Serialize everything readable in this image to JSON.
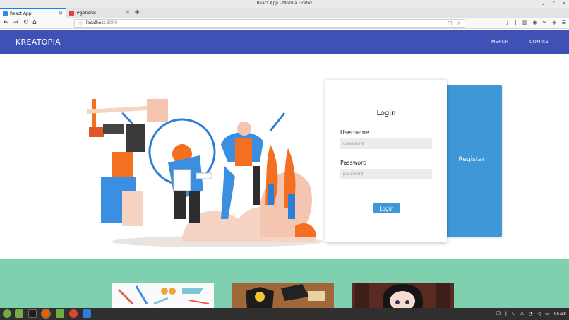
{
  "window": {
    "title": "React App - Mozilla Firefox",
    "controls": [
      "⌄",
      "⌃",
      "✕"
    ]
  },
  "tabs": [
    {
      "label": "React App",
      "active": true
    },
    {
      "label": "#general",
      "active": false
    }
  ],
  "toolbar": {
    "new_tab": "+",
    "back": "←",
    "forward": "→",
    "reload": "↻",
    "home": "⌂",
    "url_host": "localhost",
    "url_port": ":3000",
    "menu": "☰"
  },
  "app": {
    "brand": "KREATOPIA",
    "nav": [
      "MERCH",
      "COMICS"
    ],
    "login": {
      "title": "Login",
      "username_label": "Username",
      "username_placeholder": "username",
      "password_label": "Password",
      "password_placeholder": "password",
      "button": "Login"
    },
    "register_label": "Register"
  },
  "taskbar": {
    "time": "05:38"
  },
  "colors": {
    "navbar": "#3f51b5",
    "accent": "#3f97d7",
    "band": "#7ed0af"
  }
}
